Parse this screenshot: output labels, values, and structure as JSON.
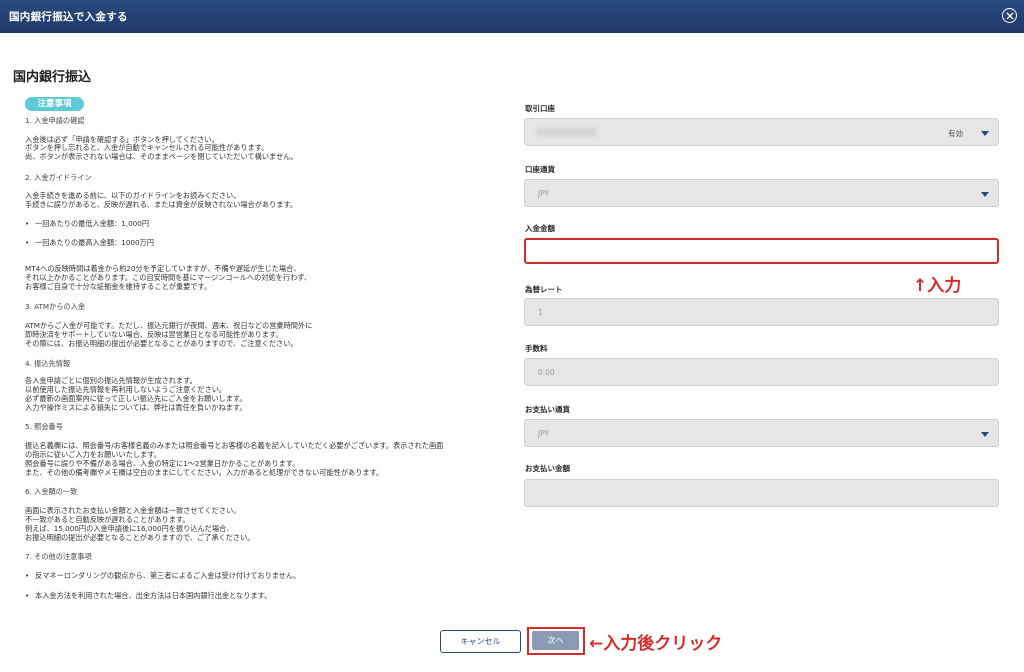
{
  "window": {
    "title": "国内銀行振込で入金する"
  },
  "page": {
    "title": "国内銀行振込"
  },
  "notice": {
    "badge": "注意事項",
    "lines": [
      {
        "kind": "heading",
        "text": "1. 入金申請の確認"
      },
      {
        "kind": "text",
        "text": "入金後は必ず「申請を確認する」ボタンを押してください。"
      },
      {
        "kind": "text",
        "text": "ボタンを押し忘れると、入金が自動でキャンセルされる可能性があります。"
      },
      {
        "kind": "text",
        "text": "尚、ボタンが表示されない場合は、そのままページを閉じていただいて構いません。"
      },
      {
        "kind": "heading",
        "text": "2. 入金ガイドライン"
      },
      {
        "kind": "text",
        "text": "入金手続きを進める前に、以下のガイドラインをお読みください。"
      },
      {
        "kind": "text",
        "text": "手続きに誤りがあると、反映が遅れる、または資金が反映されない場合があります。"
      },
      {
        "kind": "bullet",
        "text": "一回あたりの最低入金額：1,000円"
      },
      {
        "kind": "bullet",
        "text": "一回あたりの最高入金額：1000万円"
      },
      {
        "kind": "text",
        "text": "MT4への反映時間は着金から約20分を予定していますが、不備や遅延が生じた場合、"
      },
      {
        "kind": "text",
        "text": "それ以上かかることがあります。この目安時間を基にマージンコールへの対処を行わず、"
      },
      {
        "kind": "text",
        "text": "お客様ご自身で十分な証拠金を維持することが重要です。"
      },
      {
        "kind": "heading",
        "text": "3. ATMからの入金"
      },
      {
        "kind": "text",
        "text": "ATMからご入金が可能です。ただし、振込元銀行が夜間、週末、祝日などの営業時間外に"
      },
      {
        "kind": "text",
        "text": "即時決済をサポートしていない場合、反映は翌営業日となる可能性があります。"
      },
      {
        "kind": "text",
        "text": "その際には、お振込明細の提出が必要となることがありますので、ご注意ください。"
      },
      {
        "kind": "heading",
        "text": "4. 振込先情報"
      },
      {
        "kind": "text",
        "text": "各入金申請ごとに個別の振込先情報が生成されます。"
      },
      {
        "kind": "text",
        "text": "以前使用した振込先情報を再利用しないようご注意ください。"
      },
      {
        "kind": "text",
        "text": "必ず最新の画面案内に従って正しい振込先にご入金をお願いします。"
      },
      {
        "kind": "text",
        "text": "入力や操作ミスによる損失については、弊社は責任を負いかねます。"
      },
      {
        "kind": "heading",
        "text": "5. 照会番号"
      },
      {
        "kind": "text",
        "text": "振込名義欄には、照会番号/お客様名義のみまたは照会番号とお客様の名義を記入していただく必要がございます。表示された画面"
      },
      {
        "kind": "text",
        "text": "の指示に従いご入力をお願いいたします。"
      },
      {
        "kind": "text",
        "text": "照会番号に誤りや不備がある場合、入金の特定に1〜2営業日かかることがあります。"
      },
      {
        "kind": "text",
        "text": "また、その他の備考欄やメモ欄は空白のままにしてください。入力があると処理ができない可能性があります。"
      },
      {
        "kind": "heading",
        "text": "6. 入金額の一致"
      },
      {
        "kind": "text",
        "text": "画面に表示されたお支払い金額と入金金額は一致させてください。"
      },
      {
        "kind": "text",
        "text": "不一致があると自動反映が遅れることがあります。"
      },
      {
        "kind": "text",
        "text": "例えば、15,000円の入金申請後に16,000円を振り込んだ場合、"
      },
      {
        "kind": "text",
        "text": "お振込明細の提出が必要となることがありますので、ご了承ください。"
      },
      {
        "kind": "heading",
        "text": "7. その他の注意事項"
      },
      {
        "kind": "bullet",
        "text": "反マネーロンダリングの観点から、第三者によるご入金は受け付けておりません。"
      },
      {
        "kind": "bullet",
        "text": "本入金方法を利用された場合、出金方法は日本国内銀行出金となります。"
      }
    ]
  },
  "form": {
    "account": {
      "label": "取引口座",
      "status": "有効"
    },
    "currency": {
      "label": "口座通貨",
      "value": "JPY"
    },
    "amount": {
      "label": "入金金額",
      "value": ""
    },
    "rate": {
      "label": "為替レート",
      "value": "1"
    },
    "fee": {
      "label": "手数料",
      "value": "0.00"
    },
    "pay_currency": {
      "label": "お支払い通貨",
      "value": "JPY"
    },
    "pay_amount": {
      "label": "お支払い金額",
      "value": ""
    }
  },
  "annotations": {
    "input_hint": "↑入力",
    "click_hint": "←入力後クリック"
  },
  "buttons": {
    "cancel": "キャンセル",
    "next": "次へ"
  },
  "colors": {
    "header": "#20396a",
    "accent": "#5fc9d8",
    "highlight": "#d72a2a"
  }
}
